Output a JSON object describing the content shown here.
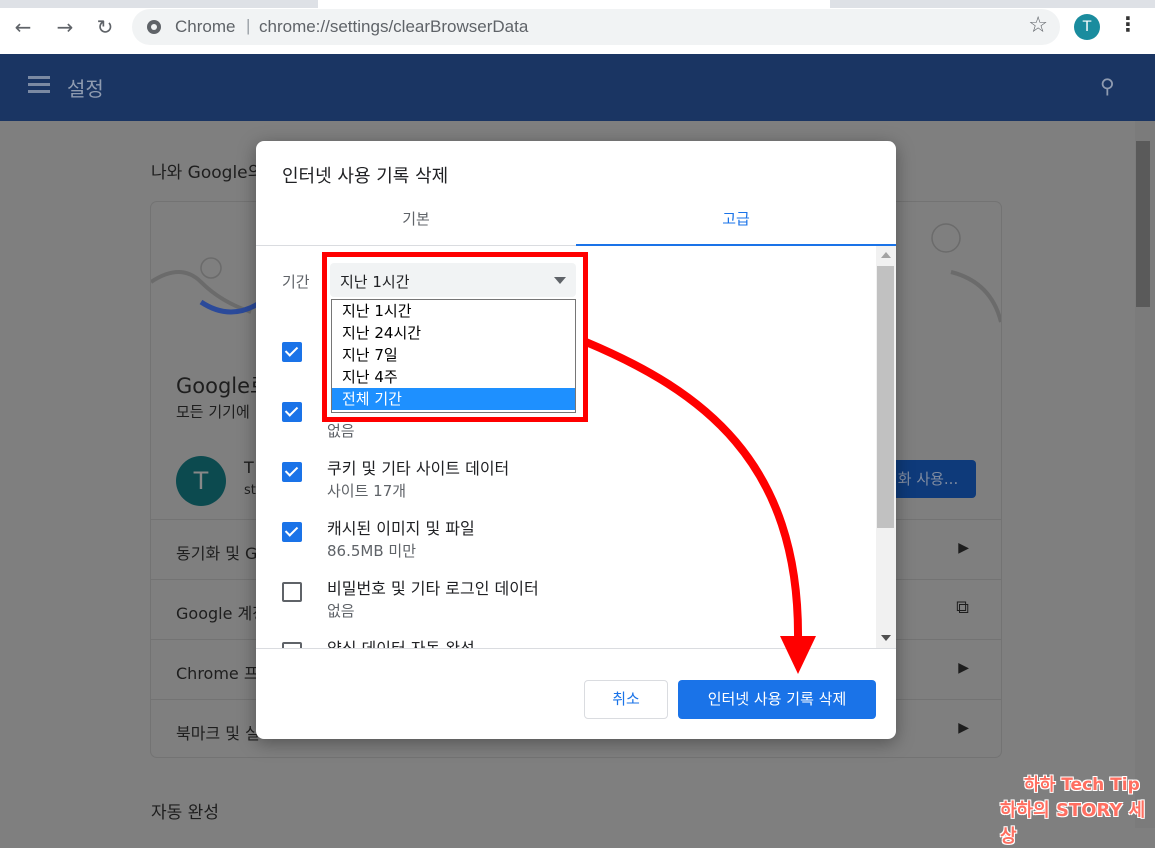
{
  "browser": {
    "origin": "Chrome",
    "separator": "|",
    "url": "chrome://settings/clearBrowserData",
    "profile_initial": "T",
    "icons": [
      "back-icon",
      "forward-icon",
      "reload-icon",
      "star-icon",
      "menu-kebab-icon"
    ]
  },
  "settings": {
    "header_title": "설정",
    "section_title": "나와 Google의",
    "google_title": "Google로",
    "google_sub": "모든 기기에",
    "avatar_initial": "T",
    "account_name": "T",
    "account_sub": "st",
    "sync_button": "화 사용...",
    "rows": [
      {
        "label": "동기화 및 G"
      },
      {
        "label": "Google 계정"
      },
      {
        "label": "Chrome 프"
      },
      {
        "label": "북마크 및 실"
      }
    ],
    "bottom_title": "자동 완성"
  },
  "dialog": {
    "title": "인터넷 사용 기록 삭제",
    "tabs": [
      "기본",
      "고급"
    ],
    "active_tab": "고급",
    "period_label": "기간",
    "period_value": "지난 1시간",
    "options": [
      "지난 1시간",
      "지난 24시간",
      "지난 7일",
      "지난 4주",
      "전체 기간"
    ],
    "selected_option": "전체 기간",
    "items": [
      {
        "title": "",
        "sub": "",
        "checked": true
      },
      {
        "title": "",
        "sub": "없음",
        "checked": true
      },
      {
        "title": "쿠키 및 기타 사이트 데이터",
        "sub": "사이트 17개",
        "checked": true
      },
      {
        "title": "캐시된 이미지 및 파일",
        "sub": "86.5MB 미만",
        "checked": true
      },
      {
        "title": "비밀번호 및 기타 로그인 데이터",
        "sub": "없음",
        "checked": false
      },
      {
        "title": "양식 데이터 자동 완성",
        "sub": "",
        "checked": false
      }
    ],
    "cancel_label": "취소",
    "clear_label": "인터넷 사용 기록 삭제"
  },
  "watermark": {
    "line1": "하하 Tech Tip",
    "line2": "하하의 STORY 세상"
  },
  "colors": {
    "accent": "#1a73e8",
    "annotation": "#ff0000",
    "header": "#1a3563"
  }
}
